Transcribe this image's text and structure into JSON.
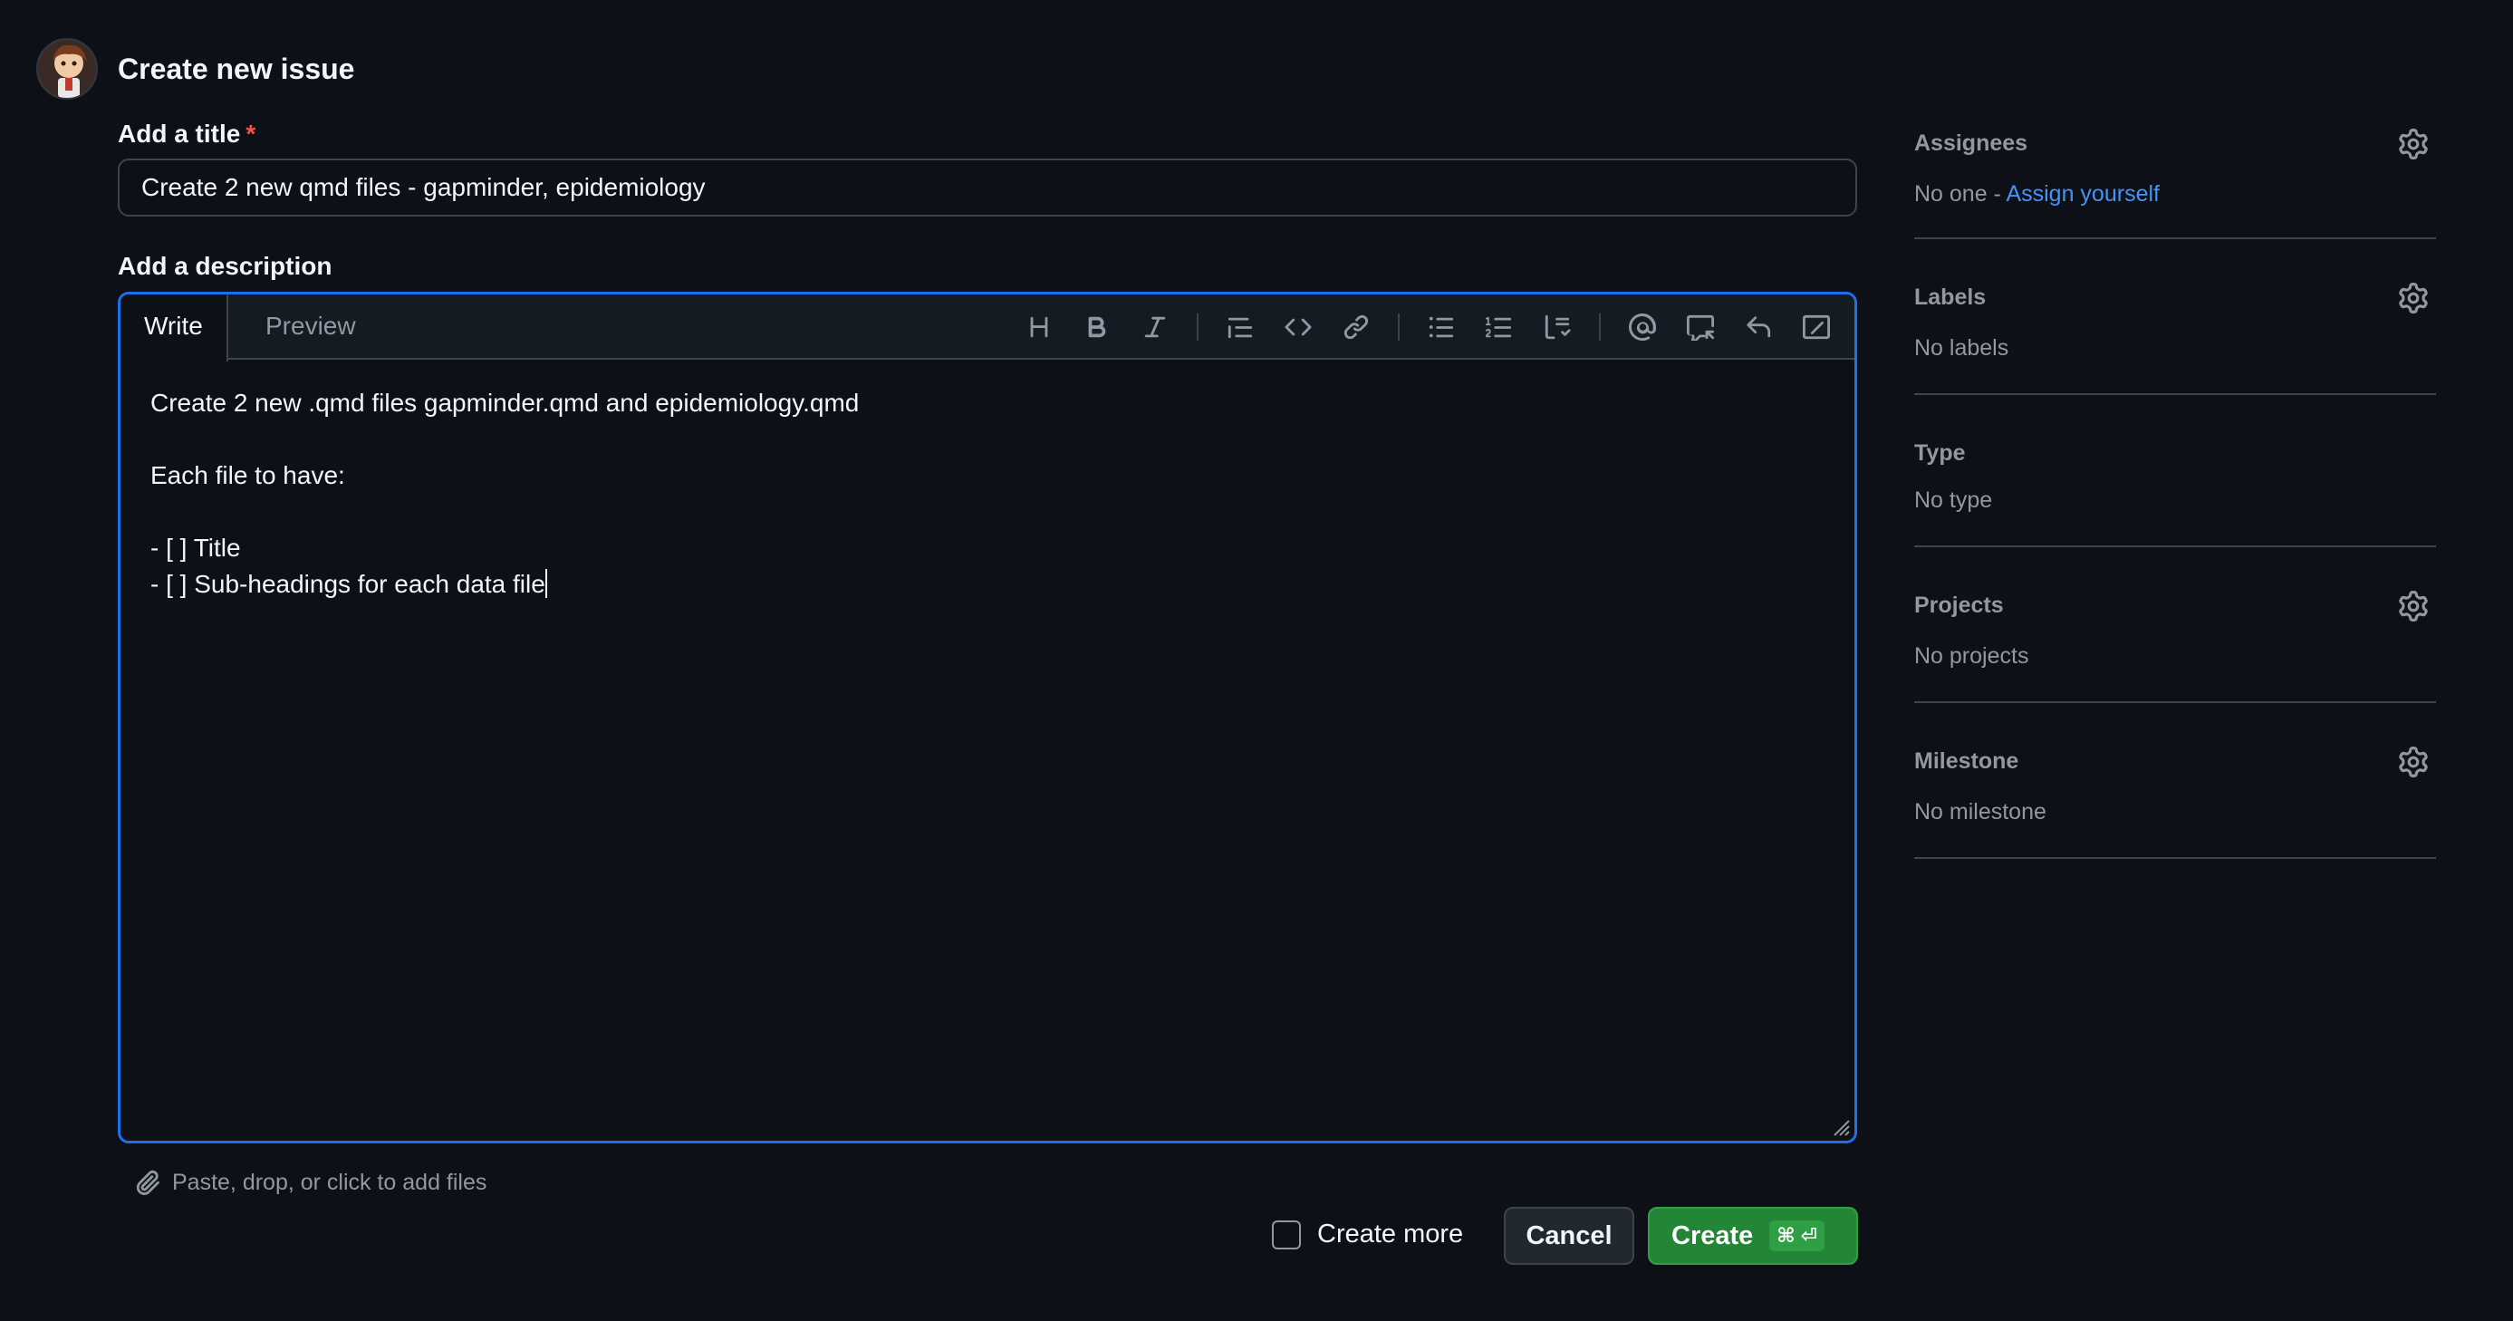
{
  "header": {
    "title": "Create new issue"
  },
  "form": {
    "title_label": "Add a title",
    "required_mark": "*",
    "title_value": "Create 2 new qmd files - gapminder, epidemiology",
    "description_label": "Add a description",
    "tabs": {
      "write": "Write",
      "preview": "Preview"
    },
    "toolbar_icons": [
      "heading-icon",
      "bold-icon",
      "italic-icon",
      "quote-icon",
      "code-icon",
      "link-icon",
      "unordered-list-icon",
      "ordered-list-icon",
      "task-list-icon",
      "mention-icon",
      "reference-icon",
      "saved-reply-icon",
      "slash-command-icon"
    ],
    "description_lines": [
      "Create 2 new .qmd files gapminder.qmd and epidemiology.qmd",
      "",
      "Each file to have:",
      "",
      "- [ ] Title",
      "- [ ] Sub-headings for each data file"
    ],
    "attach_text": "Paste, drop, or click to add files",
    "create_more_label": "Create more",
    "cancel_label": "Cancel",
    "create_label": "Create",
    "create_shortcut": "⌘ ⏎"
  },
  "sidebar": {
    "assignees": {
      "title": "Assignees",
      "value": "No one - ",
      "link": "Assign yourself"
    },
    "labels": {
      "title": "Labels",
      "value": "No labels"
    },
    "type": {
      "title": "Type",
      "value": "No type"
    },
    "projects": {
      "title": "Projects",
      "value": "No projects"
    },
    "milestone": {
      "title": "Milestone",
      "value": "No milestone"
    }
  },
  "colors": {
    "accent": "#1f6feb",
    "create_button": "#238636",
    "link": "#4493f8",
    "required": "#f85149"
  }
}
